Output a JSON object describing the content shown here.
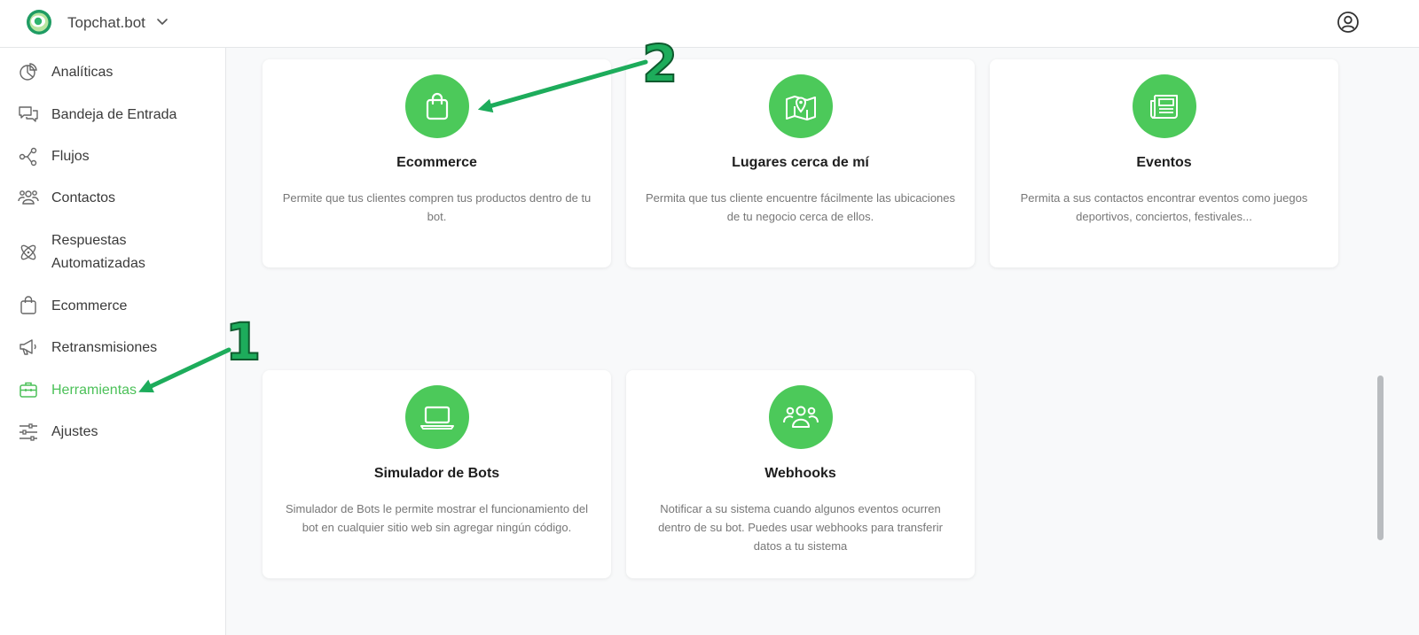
{
  "header": {
    "brand": "Topchat.bot"
  },
  "sidebar": {
    "items": [
      {
        "label": "Analíticas",
        "icon": "pie-chart-icon"
      },
      {
        "label": "Bandeja de Entrada",
        "icon": "chat-bubbles-icon"
      },
      {
        "label": "Flujos",
        "icon": "flow-nodes-icon"
      },
      {
        "label": "Contactos",
        "icon": "users-icon"
      },
      {
        "label": "Respuestas Automatizadas",
        "icon": "atom-icon"
      },
      {
        "label": "Ecommerce",
        "icon": "shopping-bag-icon"
      },
      {
        "label": "Retransmisiones",
        "icon": "megaphone-icon"
      },
      {
        "label": "Herramientas",
        "icon": "toolbox-icon",
        "active": true
      },
      {
        "label": "Ajustes",
        "icon": "sliders-icon"
      }
    ]
  },
  "cards": [
    {
      "title": "Ecommerce",
      "desc": "Permite que tus clientes compren tus productos dentro de tu bot.",
      "icon": "shopping-bag-icon"
    },
    {
      "title": "Lugares cerca de mí",
      "desc": "Permita que tus cliente encuentre fácilmente las ubicaciones de tu negocio cerca de ellos.",
      "icon": "map-pin-icon"
    },
    {
      "title": "Eventos",
      "desc": "Permita a sus contactos encontrar eventos como juegos deportivos, conciertos, festivales...",
      "icon": "newspaper-icon"
    },
    {
      "title": "Simulador de Bots",
      "desc": "Simulador de Bots le permite mostrar el funcionamiento del bot en cualquier sitio web sin agregar ningún código.",
      "icon": "laptop-icon"
    },
    {
      "title": "Webhooks",
      "desc": "Notificar a su sistema cuando algunos eventos ocurren dentro de su bot. Puedes usar webhooks para transferir datos a tu sistema",
      "icon": "group-icon"
    }
  ],
  "annotations": {
    "step1": "1",
    "step2": "2"
  },
  "colors": {
    "accent": "#4cc95a",
    "active_text": "#4cc159",
    "annotation": "#1dac5b"
  }
}
